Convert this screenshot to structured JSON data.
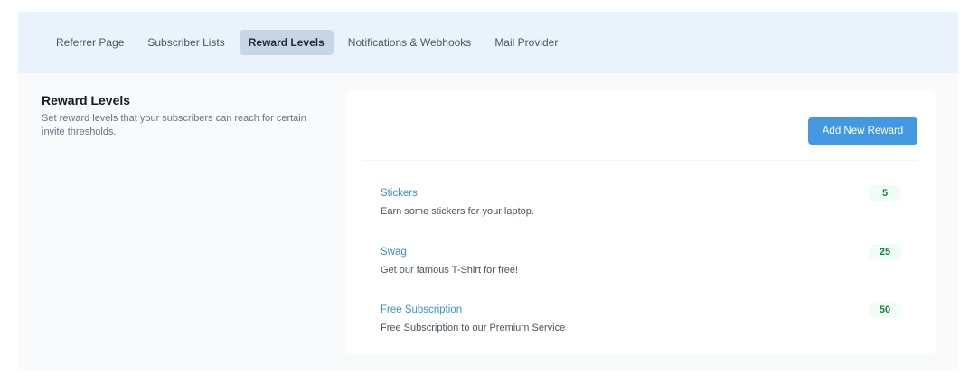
{
  "tabs": [
    {
      "label": "Referrer Page",
      "active": false
    },
    {
      "label": "Subscriber Lists",
      "active": false
    },
    {
      "label": "Reward Levels",
      "active": true
    },
    {
      "label": "Notifications & Webhooks",
      "active": false
    },
    {
      "label": "Mail Provider",
      "active": false
    }
  ],
  "section": {
    "title": "Reward Levels",
    "description": "Set reward levels that your subscribers can reach for certain invite thresholds."
  },
  "panel": {
    "add_button_label": "Add New Reward",
    "rewards": [
      {
        "name": "Stickers",
        "description": "Earn some stickers for your laptop.",
        "threshold": "5"
      },
      {
        "name": "Swag",
        "description": "Get our famous T-Shirt for free!",
        "threshold": "25"
      },
      {
        "name": "Free Subscription",
        "description": "Free Subscription to our Premium Service",
        "threshold": "50"
      }
    ]
  },
  "colors": {
    "tabbar_bg": "#eaf3fc",
    "active_tab_bg": "#c6d6e6",
    "accent": "#4299e1",
    "link": "#3b8ed8",
    "badge_text": "#15803d",
    "badge_bg": "#f0fdf4"
  }
}
